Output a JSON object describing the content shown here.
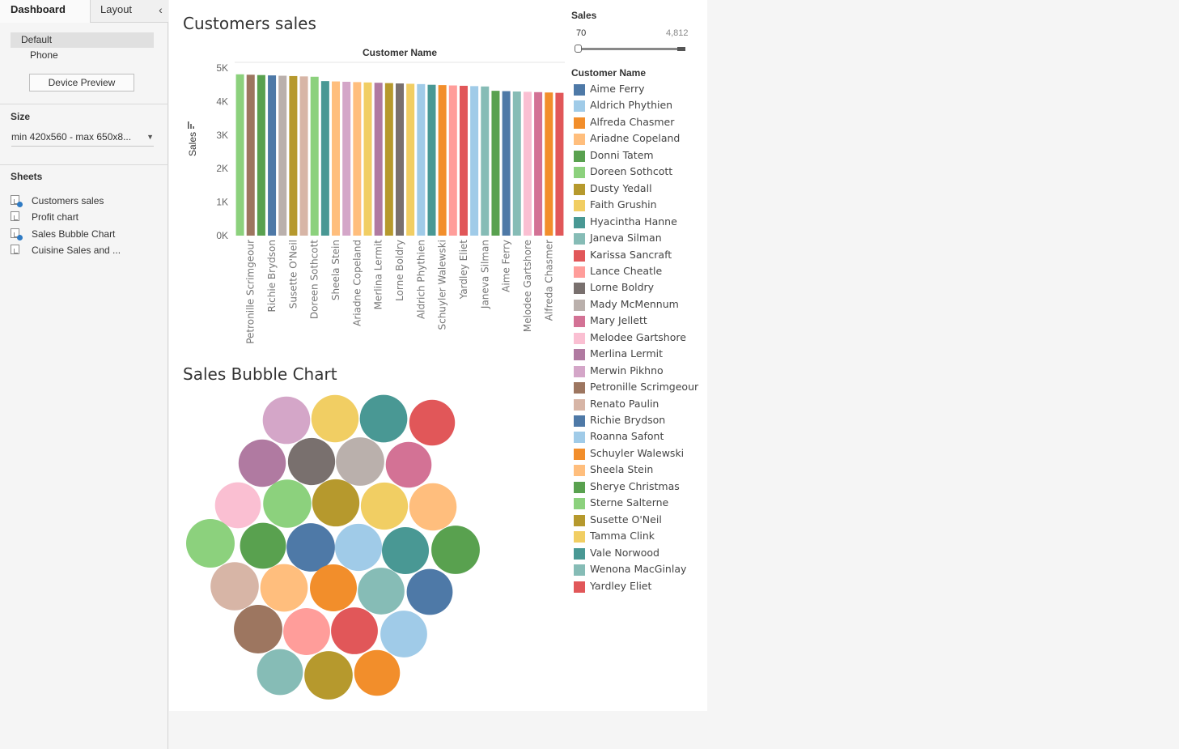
{
  "left_panel": {
    "tabs": {
      "dashboard": "Dashboard",
      "layout": "Layout",
      "collapse_icon": "‹"
    },
    "devices": [
      "Default",
      "Phone"
    ],
    "device_preview_button": "Device Preview",
    "size": {
      "title": "Size",
      "value": "min 420x560 - max 650x8..."
    },
    "sheets": {
      "title": "Sheets",
      "items": [
        {
          "label": "Customers sales",
          "used": true
        },
        {
          "label": "Profit chart",
          "used": false
        },
        {
          "label": "Sales Bubble Chart",
          "used": true
        },
        {
          "label": "Cuisine Sales and ...",
          "used": false
        }
      ]
    }
  },
  "sales_filter": {
    "title": "Sales",
    "min": "70",
    "max": "4,812"
  },
  "legend": {
    "title": "Customer Name",
    "items": [
      {
        "name": "Aime Ferry",
        "color": "#4e79a7"
      },
      {
        "name": "Aldrich Phythien",
        "color": "#a0cbe8"
      },
      {
        "name": "Alfreda Chasmer",
        "color": "#f28e2b"
      },
      {
        "name": "Ariadne Copeland",
        "color": "#ffbe7d"
      },
      {
        "name": "Donni Tatem",
        "color": "#59a14f"
      },
      {
        "name": "Doreen Sothcott",
        "color": "#8cd17d"
      },
      {
        "name": "Dusty Yedall",
        "color": "#b6992d"
      },
      {
        "name": "Faith Grushin",
        "color": "#f1ce63"
      },
      {
        "name": "Hyacintha Hanne",
        "color": "#499894"
      },
      {
        "name": "Janeva Silman",
        "color": "#86bcb6"
      },
      {
        "name": "Karissa Sancraft",
        "color": "#e15759"
      },
      {
        "name": "Lance Cheatle",
        "color": "#ff9d9a"
      },
      {
        "name": "Lorne Boldry",
        "color": "#79706e"
      },
      {
        "name": "Mady McMennum",
        "color": "#bab0ac"
      },
      {
        "name": "Mary Jellett",
        "color": "#d37295"
      },
      {
        "name": "Melodee Gartshore",
        "color": "#fabfd2"
      },
      {
        "name": "Merlina Lermit",
        "color": "#b07aa1"
      },
      {
        "name": "Merwin Pikhno",
        "color": "#d4a6c8"
      },
      {
        "name": "Petronille Scrimgeour",
        "color": "#9d7660"
      },
      {
        "name": "Renato Paulin",
        "color": "#d7b5a6"
      },
      {
        "name": "Richie Brydson",
        "color": "#4e79a7"
      },
      {
        "name": "Roanna Safont",
        "color": "#a0cbe8"
      },
      {
        "name": "Schuyler Walewski",
        "color": "#f28e2b"
      },
      {
        "name": "Sheela Stein",
        "color": "#ffbe7d"
      },
      {
        "name": "Sherye Christmas",
        "color": "#59a14f"
      },
      {
        "name": "Sterne Salterne",
        "color": "#8cd17d"
      },
      {
        "name": "Susette O'Neil",
        "color": "#b6992d"
      },
      {
        "name": "Tamma Clink",
        "color": "#f1ce63"
      },
      {
        "name": "Vale Norwood",
        "color": "#499894"
      },
      {
        "name": "Wenona MacGinlay",
        "color": "#86bcb6"
      },
      {
        "name": "Yardley Eliet",
        "color": "#e15759"
      }
    ]
  },
  "chart_data": [
    {
      "type": "bar",
      "title": "Customers sales",
      "xlabel": "Customer Name",
      "ylabel": "Sales",
      "ylim": [
        0,
        5000
      ],
      "ytick_labels": [
        "0K",
        "1K",
        "2K",
        "3K",
        "4K",
        "5K"
      ],
      "grid": false,
      "categories": [
        "Sterne Salterne",
        "Petronille Scrimgeour",
        "Sherye Christmas",
        "Richie Brydson",
        "Mady McMennum",
        "Susette O'Neil",
        "Renato Paulin",
        "Doreen Sothcott",
        "Hyacintha Hanne",
        "Sheela Stein",
        "Merwin Pikhno",
        "Ariadne Copeland",
        "Faith Grushin",
        "Merlina Lermit",
        "Dusty Yedall",
        "Lorne Boldry",
        "Tamma Clink",
        "Aldrich Phythien",
        "Vale Norwood",
        "Schuyler Walewski",
        "Lance Cheatle",
        "Yardley Eliet",
        "Roanna Safont",
        "Janeva Silman",
        "Donni Tatem",
        "Aime Ferry",
        "Wenona MacGinlay",
        "Melodee Gartshore",
        "Mary Jellett",
        "Alfreda Chasmer",
        "Karissa Sancraft"
      ],
      "visible_tick_labels": [
        "Petronille Scrimgeour",
        "Richie Brydson",
        "Susette O'Neil",
        "Doreen Sothcott",
        "Sheela Stein",
        "Ariadne Copeland",
        "Merlina Lermit",
        "Lorne Boldry",
        "Aldrich Phythien",
        "Schuyler Walewski",
        "Yardley Eliet",
        "Janeva Silman",
        "Aime Ferry",
        "Melodee Gartshore",
        "Alfreda Chasmer"
      ],
      "values": [
        4812,
        4800,
        4790,
        4780,
        4770,
        4760,
        4750,
        4740,
        4610,
        4600,
        4590,
        4580,
        4570,
        4560,
        4550,
        4540,
        4530,
        4520,
        4500,
        4490,
        4480,
        4470,
        4460,
        4450,
        4320,
        4310,
        4300,
        4290,
        4280,
        4270,
        4260
      ]
    },
    {
      "type": "bubble",
      "title": "Sales Bubble Chart",
      "bubbles": [
        {
          "name": "Merwin Pikhno",
          "value": 4590
        },
        {
          "name": "Faith Grushin",
          "value": 4570
        },
        {
          "name": "Hyacintha Hanne",
          "value": 4610
        },
        {
          "name": "Karissa Sancraft",
          "value": 4260
        },
        {
          "name": "Merlina Lermit",
          "value": 4560
        },
        {
          "name": "Lorne Boldry",
          "value": 4540
        },
        {
          "name": "Mady McMennum",
          "value": 4770
        },
        {
          "name": "Mary Jellett",
          "value": 4280
        },
        {
          "name": "Melodee Gartshore",
          "value": 4290
        },
        {
          "name": "Doreen Sothcott",
          "value": 4740
        },
        {
          "name": "Dusty Yedall",
          "value": 4550
        },
        {
          "name": "Tamma Clink",
          "value": 4530
        },
        {
          "name": "Ariadne Copeland",
          "value": 4580
        },
        {
          "name": "Sterne Salterne",
          "value": 4812
        },
        {
          "name": "Donni Tatem",
          "value": 4320
        },
        {
          "name": "Richie Brydson",
          "value": 4780
        },
        {
          "name": "Aldrich Phythien",
          "value": 4520
        },
        {
          "name": "Vale Norwood",
          "value": 4500
        },
        {
          "name": "Sherye Christmas",
          "value": 4790
        },
        {
          "name": "Renato Paulin",
          "value": 4750
        },
        {
          "name": "Sheela Stein",
          "value": 4600
        },
        {
          "name": "Schuyler Walewski",
          "value": 4490
        },
        {
          "name": "Janeva Silman",
          "value": 4450
        },
        {
          "name": "Aime Ferry",
          "value": 4310
        },
        {
          "name": "Petronille Scrimgeour",
          "value": 4800
        },
        {
          "name": "Lance Cheatle",
          "value": 4480
        },
        {
          "name": "Yardley Eliet",
          "value": 4470
        },
        {
          "name": "Roanna Safont",
          "value": 4460
        },
        {
          "name": "Wenona MacGinlay",
          "value": 4300
        },
        {
          "name": "Susette O'Neil",
          "value": 4760
        },
        {
          "name": "Alfreda Chasmer",
          "value": 4270
        }
      ]
    }
  ]
}
